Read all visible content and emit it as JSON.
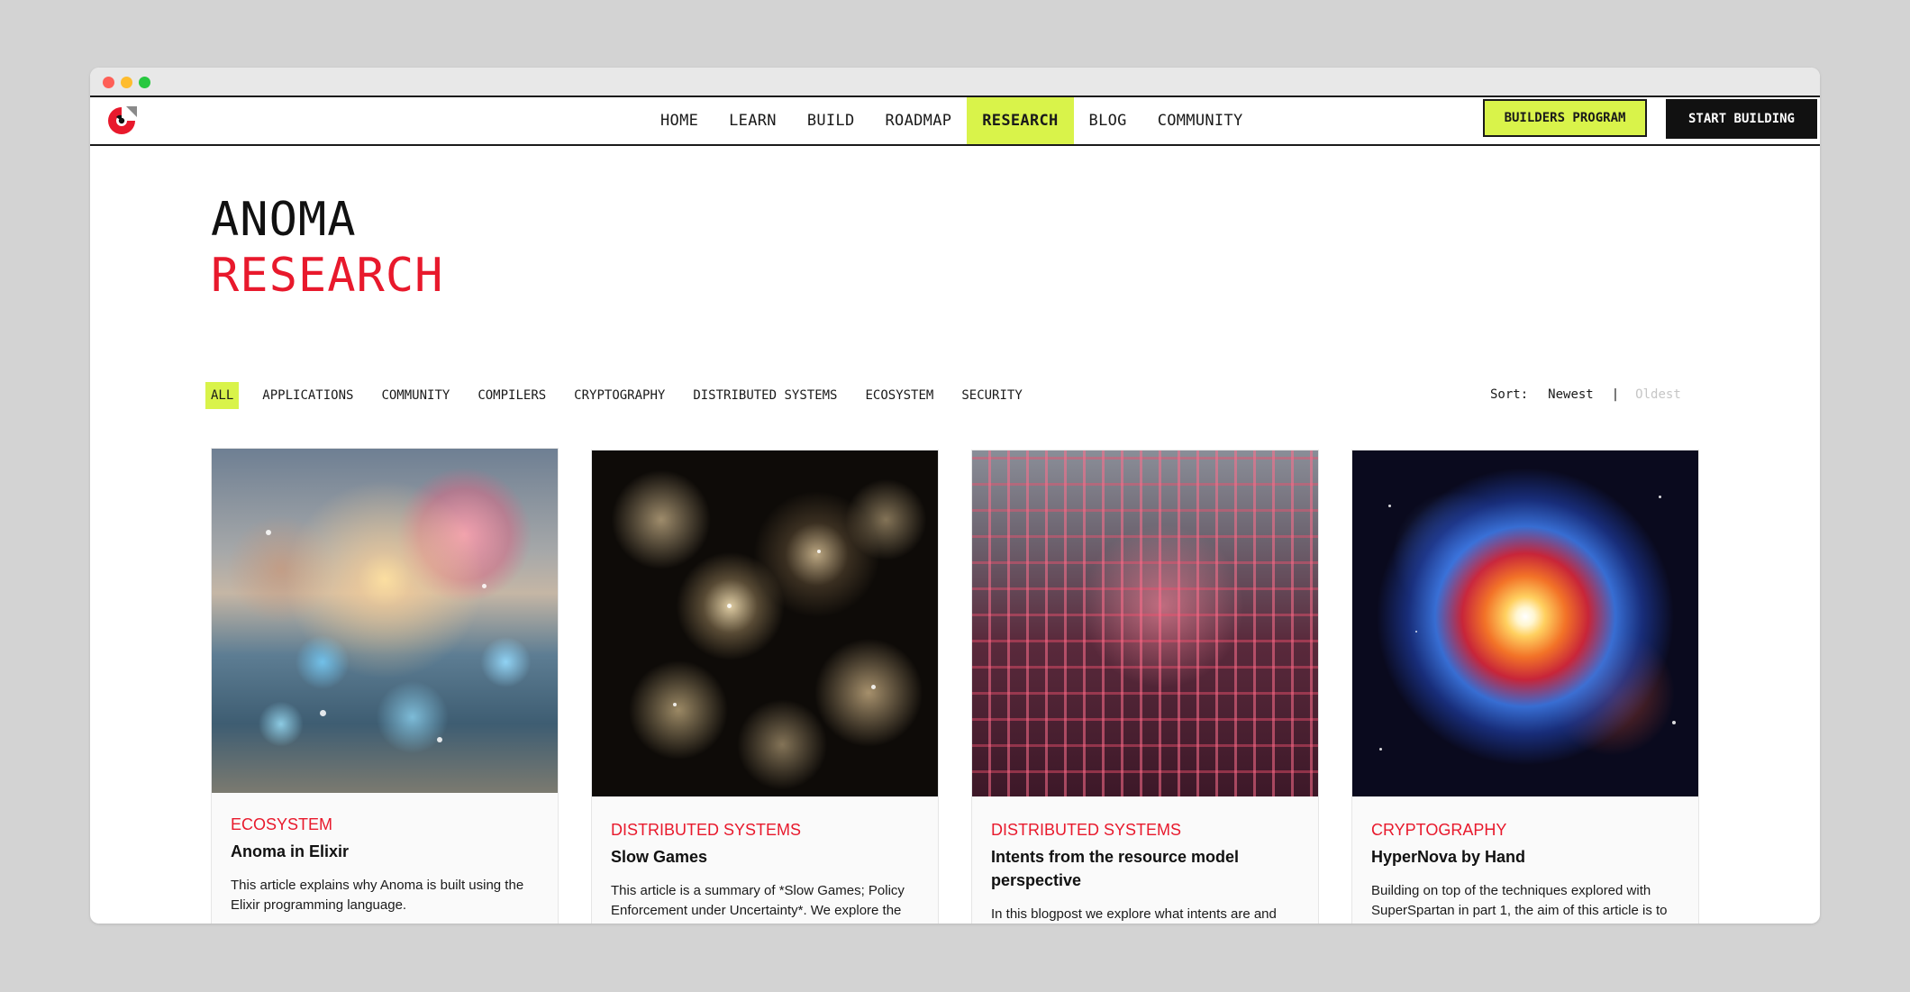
{
  "nav": {
    "links": [
      {
        "label": "HOME"
      },
      {
        "label": "LEARN"
      },
      {
        "label": "BUILD"
      },
      {
        "label": "ROADMAP"
      },
      {
        "label": "RESEARCH",
        "active": true
      },
      {
        "label": "BLOG"
      },
      {
        "label": "COMMUNITY"
      }
    ],
    "builders_label": "BUILDERS PROGRAM",
    "start_label": "START BUILDING"
  },
  "hero": {
    "line1": "ANOMA",
    "line2": "RESEARCH"
  },
  "filters": [
    "ALL",
    "APPLICATIONS",
    "COMMUNITY",
    "COMPILERS",
    "CRYPTOGRAPHY",
    "DISTRIBUTED SYSTEMS",
    "ECOSYSTEM",
    "SECURITY"
  ],
  "sort": {
    "label": "Sort:",
    "newest": "Newest",
    "separator": "|",
    "oldest": "Oldest"
  },
  "cards": [
    {
      "category": "ECOSYSTEM",
      "title": "Anoma in Elixir",
      "description": "This article explains why Anoma is built using the Elixir programming language."
    },
    {
      "category": "DISTRIBUTED SYSTEMS",
      "title": "Slow Games",
      "description": "This article is a summary of *Slow Games; Policy Enforcement under Uncertainty*. We explore the class of mechanisms commonly used for..."
    },
    {
      "category": "DISTRIBUTED SYSTEMS",
      "title": "Intents from the resource model perspective",
      "description": "In this blogpost we explore what intents are and how they..."
    },
    {
      "category": "CRYPTOGRAPHY",
      "title": "HyperNova by Hand",
      "description": "Building on top of the techniques explored with SuperSpartan in part 1, the aim of this article is to unbundle the folding mechanism of the..."
    }
  ],
  "colors": {
    "accent": "#d9f34a",
    "brand_red": "#e8192c",
    "dark": "#111111"
  },
  "icons": {
    "logo": "anoma-logo-icon"
  }
}
